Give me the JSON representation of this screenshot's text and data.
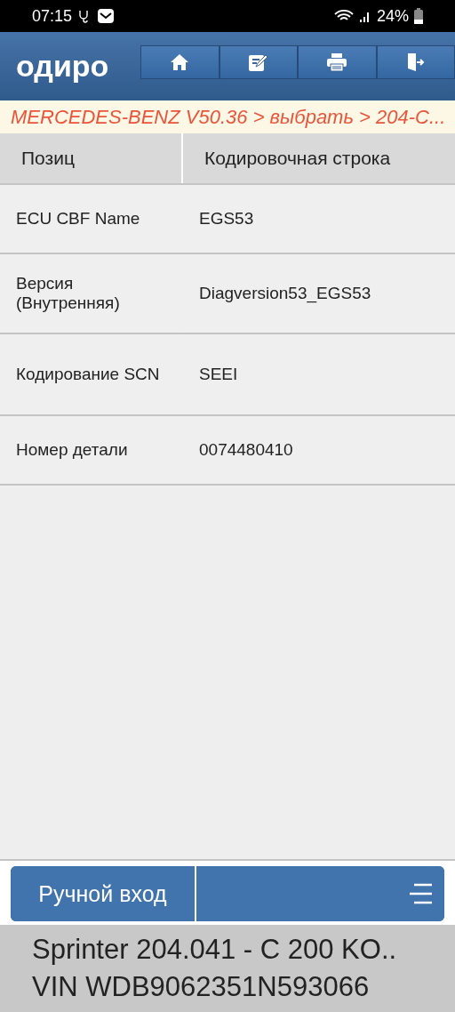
{
  "status_bar": {
    "time": "07:15",
    "battery": "24%"
  },
  "header": {
    "logo": "одиро",
    "buttons": [
      {
        "kind": "home"
      },
      {
        "kind": "edit"
      },
      {
        "kind": "print"
      },
      {
        "kind": "exit"
      }
    ]
  },
  "breadcrumb": "MERCEDES-BENZ V50.36 > выбрать > 204-C...",
  "table": {
    "columns": [
      "Позиц",
      "Кодировочная строка"
    ],
    "rows": [
      [
        "ECU CBF Name",
        "EGS53"
      ],
      [
        "Версия (Внутренняя)",
        "Diagversion53_EGS53"
      ],
      [
        "Кодирование SCN",
        "SEEI"
      ],
      [
        "Номер детали",
        "0074480410"
      ]
    ]
  },
  "bottom_bar": {
    "button": "Ручной вход"
  },
  "footer": {
    "model": "Sprinter 204.041 - C 200 KO..",
    "vin": "VIN WDB9062351N593066"
  }
}
